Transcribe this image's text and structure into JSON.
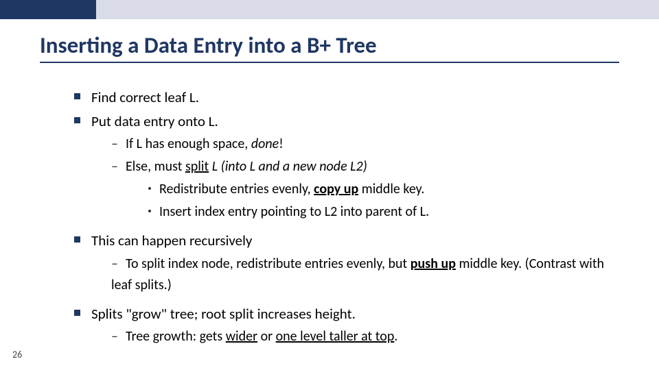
{
  "title": "Inserting a Data Entry into a B+ Tree",
  "b1": "Find correct leaf L.",
  "b2": "Put data entry onto L.",
  "b2a_pre": "If L has enough space, ",
  "b2a_done": "done",
  "b2b_pre": "Else, must ",
  "b2b_split": "split",
  "b2b_post": "  L (into L and a new node L2)",
  "b2b_i_pre": "Redistribute entries evenly, ",
  "b2b_i_bold": "copy up",
  "b2b_i_post": " middle key.",
  "b2b_ii": "Insert index entry pointing to L2 into parent of L.",
  "b3": "This can happen recursively",
  "b3a_pre": "To split index node, redistribute entries evenly, but ",
  "b3a_bold": "push up",
  "b3a_post": " middle key.  (Contrast with leaf splits.)",
  "b4": "Splits \"grow\" tree; root split increases height.",
  "b4a_pre": "Tree growth: gets ",
  "b4a_u1": "wider",
  "b4a_mid": " or ",
  "b4a_u2": "one level taller at top",
  "page": "26"
}
